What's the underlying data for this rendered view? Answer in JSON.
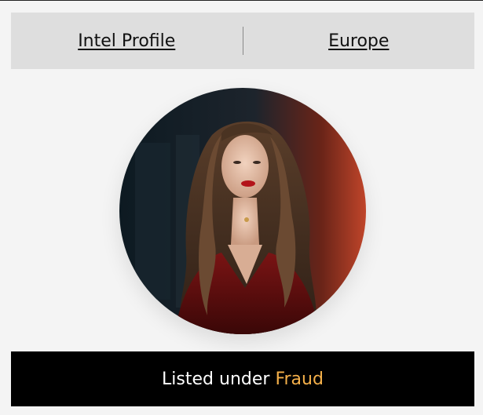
{
  "tabs": [
    {
      "label": "Intel Profile"
    },
    {
      "label": "Europe"
    }
  ],
  "profile": {
    "avatar": "profile-photo"
  },
  "status": {
    "prefix": "Listed under",
    "category": "Fraud"
  },
  "colors": {
    "page_background": "#f4f4f4",
    "tab_background": "#dedede",
    "status_background": "#000000",
    "accent": "#f5b04a"
  }
}
